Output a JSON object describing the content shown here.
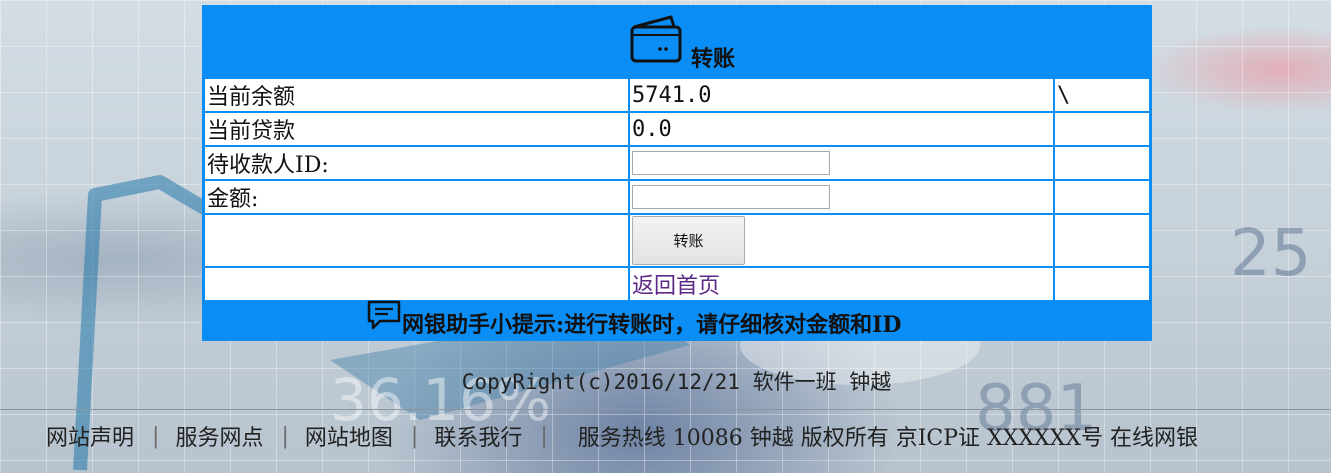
{
  "header": {
    "title": "转账",
    "icon": "wallet-icon"
  },
  "rows": {
    "balance_label": "当前余额",
    "balance_value": "5741.0",
    "balance_extra": "\\",
    "loan_label": "当前贷款",
    "loan_value": "0.0",
    "payee_label": "待收款人ID:",
    "payee_value": "",
    "amount_label": "金额:",
    "amount_value": ""
  },
  "buttons": {
    "submit_label": "转账",
    "back_link": "返回首页"
  },
  "tip": {
    "icon": "chat-icon",
    "text": "网银助手小提示:进行转账时，请仔细核对金额和ID"
  },
  "copyright": "CopyRight(c)2016/12/21 软件一班 钟越",
  "footer": {
    "links": [
      "网站声明",
      "服务网点",
      "网站地图",
      "联系我行"
    ],
    "separator": "|",
    "info": "服务热线 10086 钟越 版权所有  京ICP证 XXXXXX号 在线网银"
  },
  "colors": {
    "accent": "#0a8ef6",
    "link_visited": "#5b2a86"
  }
}
